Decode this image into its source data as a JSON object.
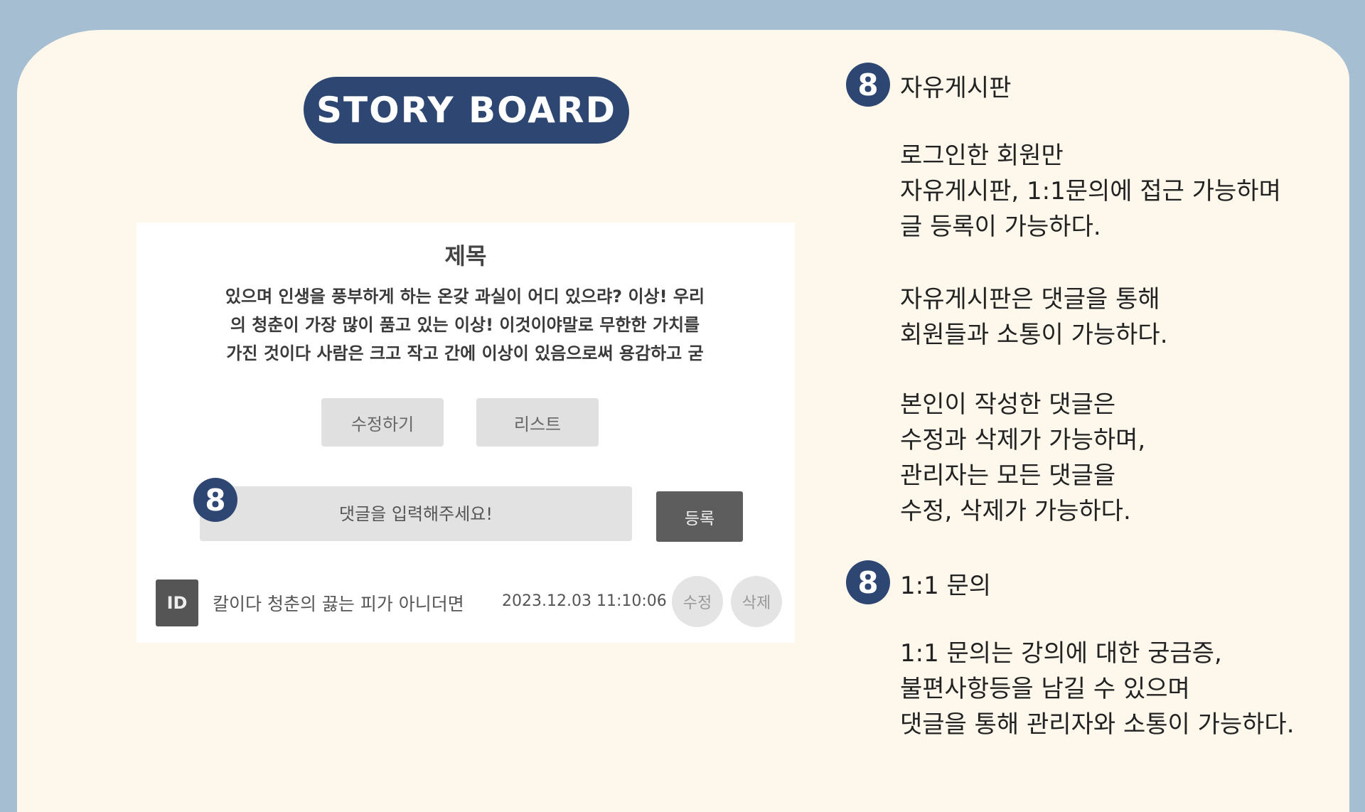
{
  "header": {
    "title": "STORY BOARD"
  },
  "post": {
    "title": "제목",
    "body_lines": [
      "있으며 인생을 풍부하게 하는 온갖 과실이 어디 있으랴? 이상! 우리",
      "의 청춘이 가장 많이 품고 있는 이상! 이것이야말로 무한한 가치를",
      "가진 것이다 사람은 크고 작고 간에 이상이 있음으로써 용감하고 굳"
    ],
    "edit_label": "수정하기",
    "list_label": "리스트"
  },
  "comment_form": {
    "badge": "8",
    "placeholder": "댓글을 입력해주세요!",
    "submit_label": "등록"
  },
  "comment": {
    "avatar": "ID",
    "text": "칼이다 청춘의 끓는 피가 아니더면",
    "timestamp": "2023.12.03 11:10:06",
    "edit_label": "수정",
    "delete_label": "삭제"
  },
  "description": {
    "section1": {
      "badge": "8",
      "title": "자유게시판",
      "paragraphs": [
        [
          "로그인한 회원만",
          "자유게시판, 1:1문의에 접근 가능하며",
          "글 등록이 가능하다."
        ],
        [
          "자유게시판은 댓글을 통해",
          "회원들과 소통이 가능하다."
        ],
        [
          "본인이 작성한 댓글은",
          "수정과 삭제가 가능하며,",
          "관리자는 모든 댓글을",
          "수정, 삭제가 가능하다."
        ]
      ]
    },
    "section2": {
      "badge": "8",
      "title": "1:1 문의",
      "paragraphs": [
        [
          "1:1 문의는 강의에 대한 궁금증,",
          "불편사항등을 남길 수 있으며",
          "댓글을 통해 관리자와 소통이 가능하다."
        ]
      ]
    }
  },
  "colors": {
    "background": "#a6bed2",
    "card": "#fef8ec",
    "accent": "#2e4672"
  }
}
